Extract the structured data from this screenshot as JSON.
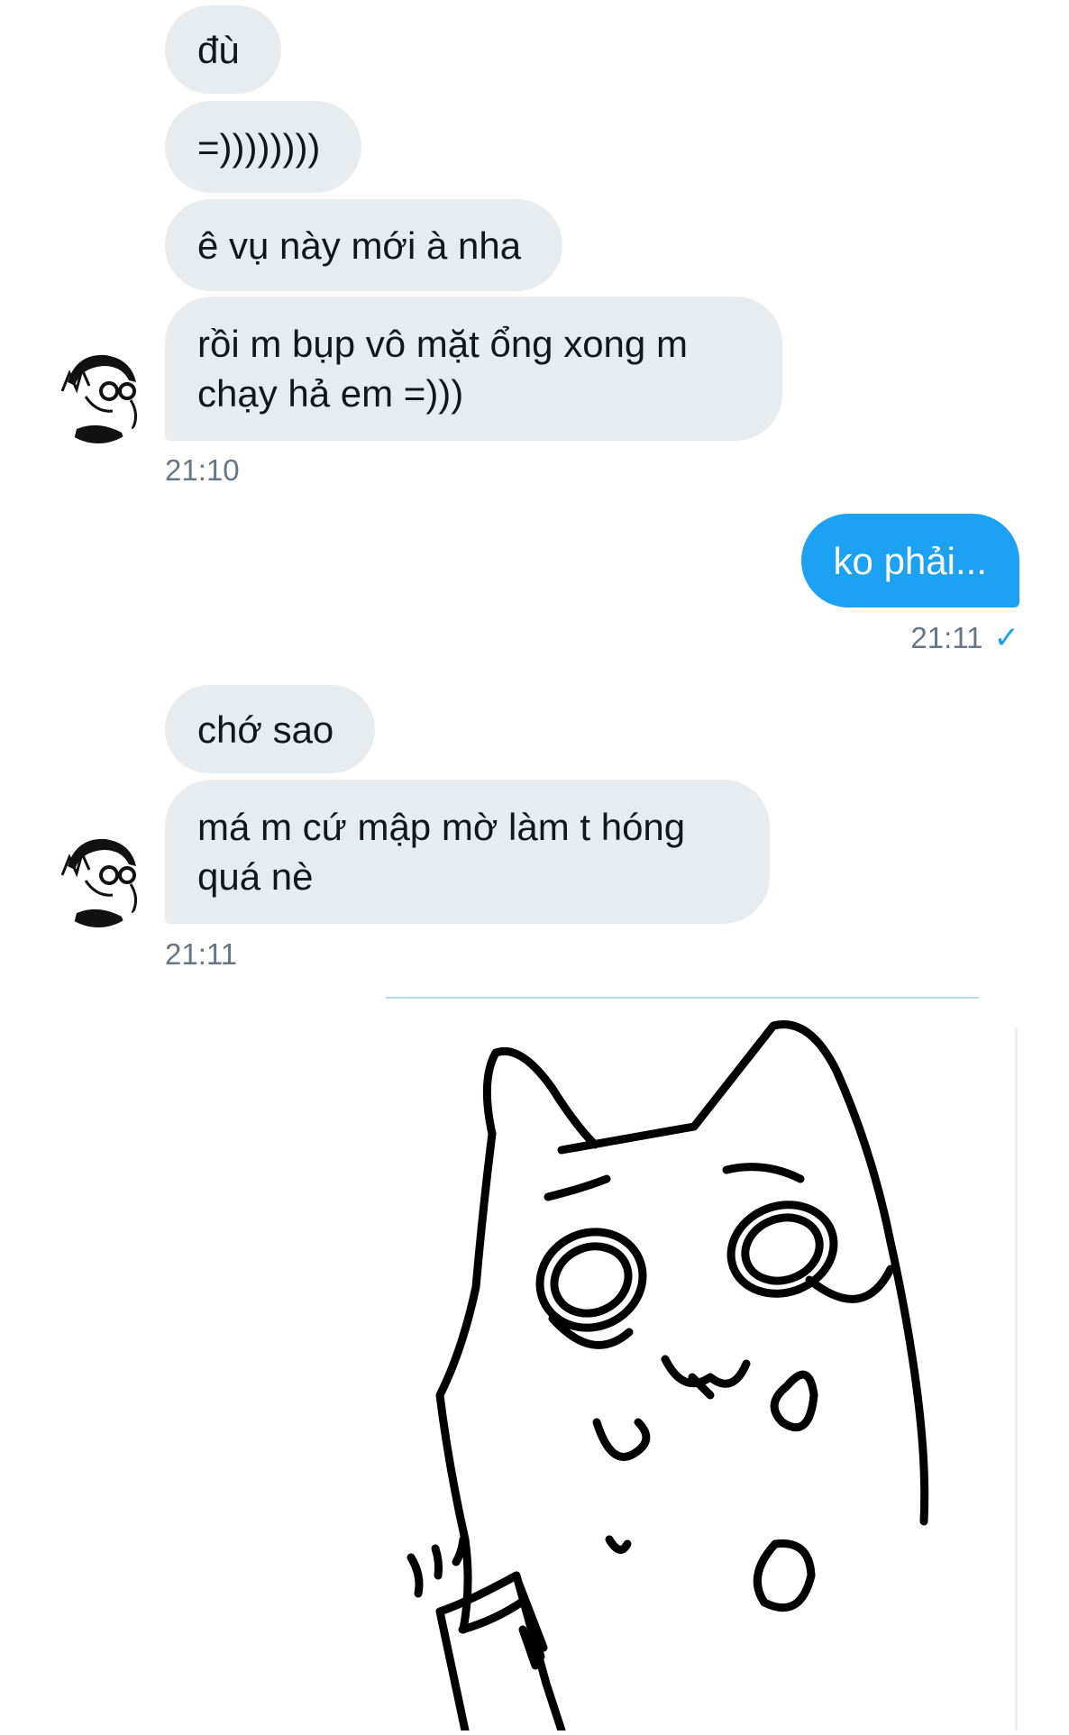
{
  "conversation": {
    "group1": {
      "messages": [
        "đù",
        "=))))))))",
        "ê vụ này mới à nha",
        "rồi m bụp vô mặt ổng xong m chạy hả em =)))"
      ],
      "time": "21:10"
    },
    "outgoing": {
      "message": "ko phải...",
      "time": "21:11"
    },
    "group2": {
      "messages": [
        "chớ sao",
        "má m cứ mập mờ làm t hóng quá nè"
      ],
      "time": "21:11"
    }
  },
  "icons": {
    "read_receipt": "checkmark-icon",
    "sticker": "crying-cat-sticker"
  },
  "colors": {
    "incoming_bubble": "#e6ecf0",
    "outgoing_bubble": "#1da1f2",
    "timestamp": "#657786"
  }
}
